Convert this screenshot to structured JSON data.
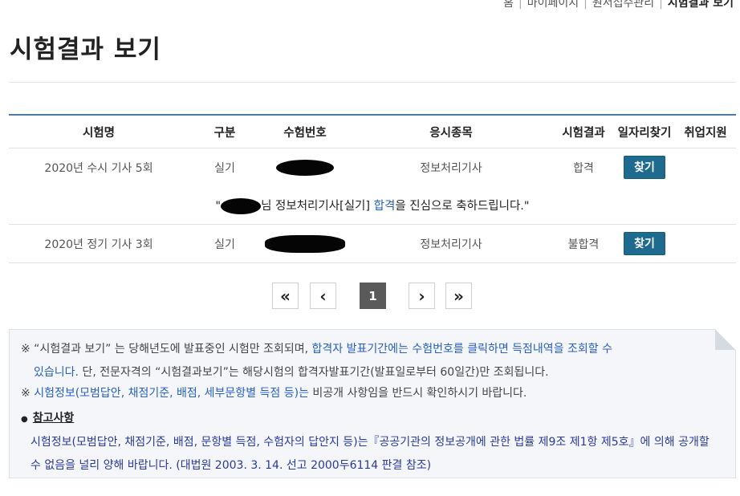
{
  "breadcrumb": {
    "items": [
      "홈",
      "마이페이지",
      "원서접수관리",
      "시험결과 보기"
    ]
  },
  "page_title": "시험결과 보기",
  "table": {
    "headers": [
      "시험명",
      "구분",
      "수험번호",
      "응시종목",
      "시험결과",
      "일자리찾기",
      "취업지원"
    ],
    "rows": [
      {
        "exam": "2020년 수시 기사 5회",
        "type": "실기",
        "result": "합격",
        "subject": "정보처리기사",
        "find": "찾기"
      },
      {
        "exam": "2020년 정기 기사 3회",
        "type": "실기",
        "result": "불합격",
        "subject": "정보처리기사",
        "find": "찾기"
      }
    ],
    "congrats": {
      "prefix": "님 정보처리기사[실기] ",
      "highlight": "합격",
      "suffix": "을 진심으로 축하드립니다.\""
    }
  },
  "pagination": {
    "first": "«",
    "prev": "‹",
    "current": "1",
    "next": "›",
    "last": "»"
  },
  "notice": {
    "mark": "※",
    "n1_a": " “시험결과 보기” 는 당해년도에 발표중인 시험만 조회되며, ",
    "n1_b": "합격자 발표기간에는 수험번호를 클릭하면 득점내역을 조회할 수",
    "n1_c": "있습니다.",
    "n1_d": " 단, 전문자격의 “시험결과보기”는 해당시험의 합격자발표기간(발표일로부터 60일간)만 조회됩니다.",
    "n2_a": "시험정보(모범답안, 채점기준, 배점, 세부문항별 득점 등)는",
    "n2_b": " 비공개 사항임을 반드시 확인하시기 바랍니다.",
    "n3_head": "참고사항",
    "n3_body": "시험정보(모범답안, 채점기준, 배점, 문항별 득점, 수험자의 답안지 등)는『공공기관의 정보공개에 관한 법률 제9조 제1항 제5호』에 의해 공개할 수 없음을 널리 양해 바랍니다. (대법원 2003. 3. 14. 선고 2000두6114 판결 참조)"
  },
  "colors": {
    "accent_blue": "#2760bf",
    "button": "#1e6b8f",
    "table_top_border": "#4b7aa8",
    "notice_bg": "#f4f6f9"
  }
}
